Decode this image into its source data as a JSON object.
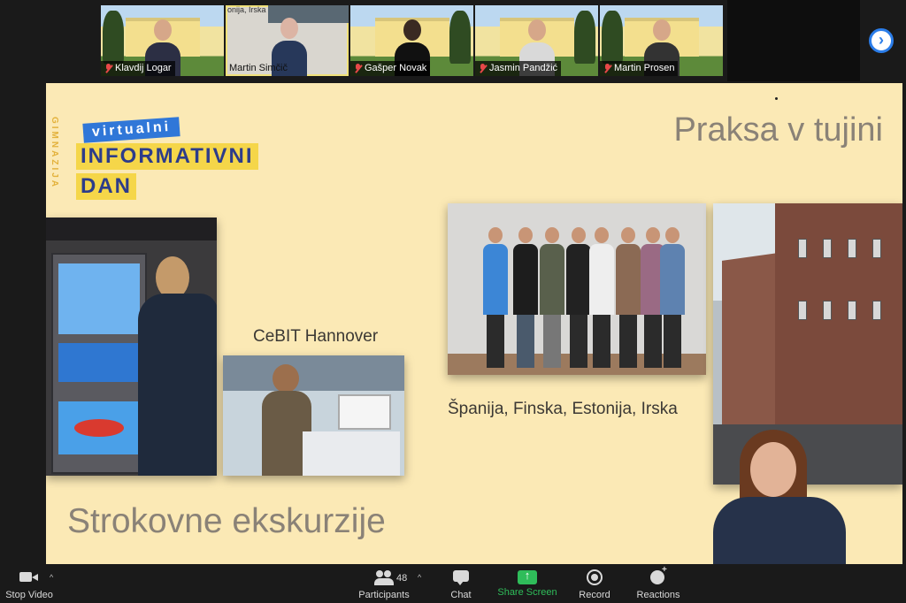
{
  "participants": [
    {
      "name": "Klavdij Logar",
      "muted": true
    },
    {
      "name": "Martin Simčič",
      "muted": false,
      "active": true,
      "overlay_text": "onija, Irska"
    },
    {
      "name": "Gašper Novak",
      "muted": true
    },
    {
      "name": "Jasmin Pandžić",
      "muted": true
    },
    {
      "name": "Martin Prosen",
      "muted": true
    }
  ],
  "next_page_icon": "chevron-right-icon",
  "slide": {
    "title": "Praksa v tujini",
    "bottom_title": "Strokovne ekskurzije",
    "logo": {
      "vertical_text": "GIMNAZIJA",
      "virtual_label": "virtualni",
      "line1": "INFORMATIVNI",
      "line2": "DAN"
    },
    "caption_cebit": "CeBIT Hannover",
    "caption_countries": "Španija, Finska, Estonija, Irska"
  },
  "toolbar": {
    "stop_video": "Stop Video",
    "participants": "Participants",
    "participants_count": "48",
    "chat": "Chat",
    "share_screen": "Share Screen",
    "record": "Record",
    "reactions": "Reactions"
  },
  "colors": {
    "slide_bg": "#fbe9b5",
    "title_text": "#8a8277",
    "logo_blue": "#3077d8",
    "logo_yellow": "#f5d649",
    "share_green": "#2fbd5a",
    "muted_red": "#e74848"
  }
}
